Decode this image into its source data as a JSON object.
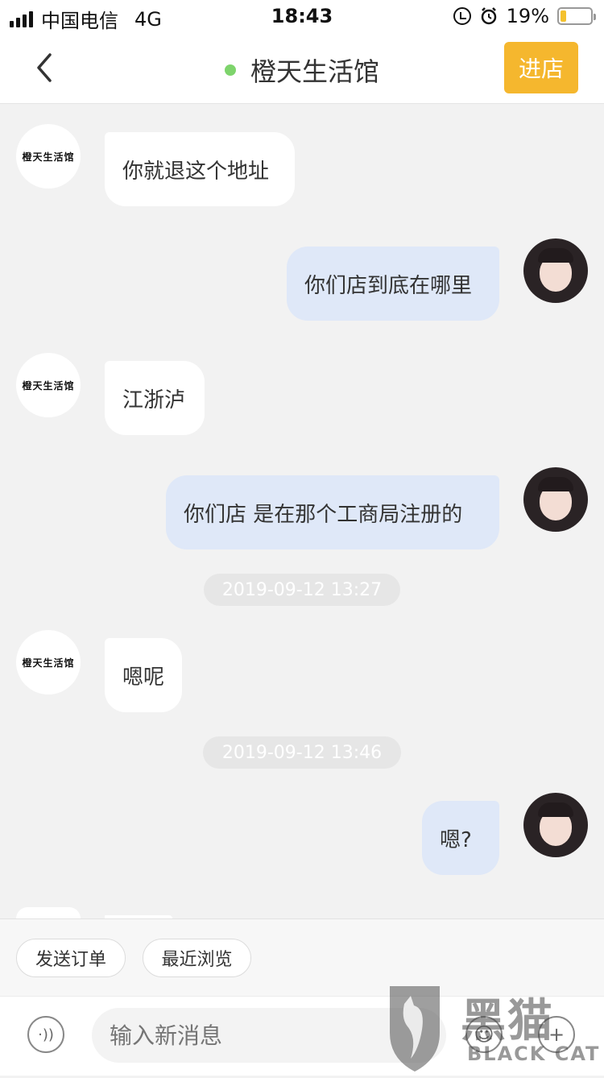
{
  "status_bar": {
    "carrier": "中国电信",
    "network": "4G",
    "time": "18:43",
    "battery_percent": "19%",
    "battery_level": 0.19,
    "icons": [
      "signal-icon",
      "orientation-lock-icon",
      "alarm-icon",
      "battery-icon"
    ]
  },
  "header": {
    "title": "橙天生活馆",
    "enter_button": "进店",
    "accent_color": "#f5b72e",
    "online_color": "#7ed46c"
  },
  "shop_avatar_text": "橙天生活馆",
  "messages": [
    {
      "side": "in",
      "text": "你就退这个地址"
    },
    {
      "side": "out",
      "text": "你们店到底在哪里"
    },
    {
      "side": "in",
      "text": "江浙泸"
    },
    {
      "side": "out",
      "text": "你们店 是在那个工商局注册的"
    },
    {
      "side": "time",
      "text": "2019-09-12 13:27"
    },
    {
      "side": "in",
      "text": "嗯呢"
    },
    {
      "side": "time",
      "text": "2019-09-12 13:46"
    },
    {
      "side": "out",
      "text": "嗯?"
    }
  ],
  "quick_actions": [
    "发送订单",
    "最近浏览"
  ],
  "input": {
    "placeholder": "输入新消息"
  },
  "watermark": {
    "name": "黑猫",
    "subtitle": "BLACK CAT"
  }
}
